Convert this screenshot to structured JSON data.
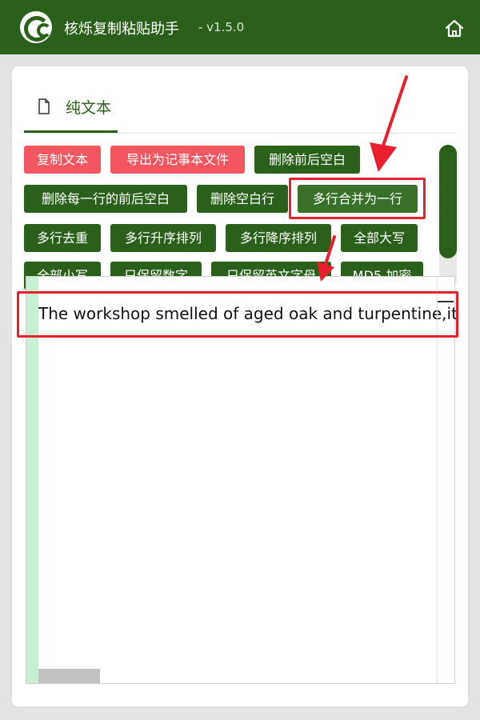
{
  "app": {
    "title": "核烁复制粘贴助手",
    "version": "- v1.5.0"
  },
  "tab": {
    "label": "纯文本"
  },
  "buttons": [
    "复制文本",
    "导出为记事本文件",
    "删除前后空白",
    "删除每一行的前后空白",
    "删除空白行",
    "多行合并为一行",
    "多行去重",
    "多行升序排列",
    "多行降序排列",
    "全部大写",
    "全部小写",
    "只保留数字",
    "只保留英文字母",
    "MD5 加密"
  ],
  "editor": {
    "text": "The workshop smelled of aged oak and turpentine,it"
  },
  "colors": {
    "brand_green": "#2a6019",
    "danger_red": "#f2565e",
    "annotation_red": "#e8202d",
    "gutter_green": "#c7efd1"
  },
  "icons": {
    "app_logo": "cc-logo",
    "home": "home-icon",
    "tab": "document-icon"
  }
}
